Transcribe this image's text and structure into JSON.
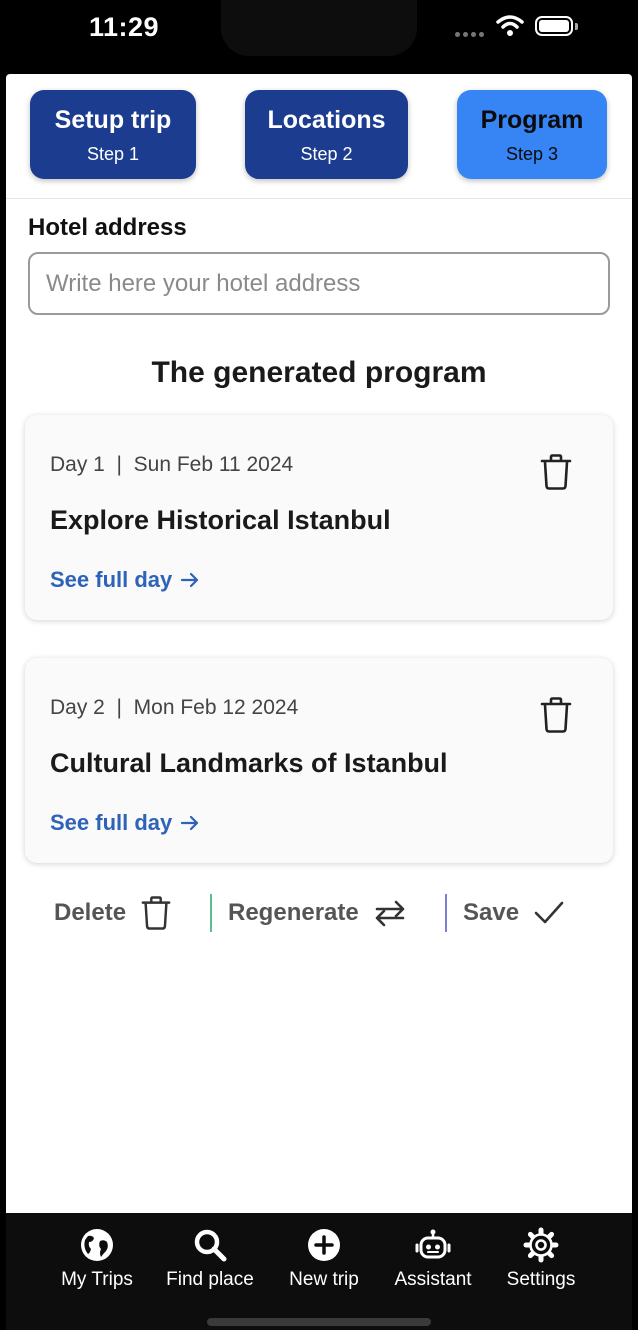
{
  "status_bar": {
    "time": "11:29"
  },
  "steps": [
    {
      "title": "Setup trip",
      "subtitle": "Step 1",
      "active": false
    },
    {
      "title": "Locations",
      "subtitle": "Step 2",
      "active": false
    },
    {
      "title": "Program",
      "subtitle": "Step 3",
      "active": true
    }
  ],
  "hotel": {
    "label": "Hotel address",
    "placeholder": "Write here your hotel address",
    "value": ""
  },
  "program": {
    "title": "The generated program",
    "days": [
      {
        "date": "Day 1  |  Sun Feb 11 2024",
        "title": "Explore Historical Istanbul",
        "link": "See full day"
      },
      {
        "date": "Day 2  |  Mon Feb 12 2024",
        "title": "Cultural Landmarks of Istanbul",
        "link": "See full day"
      }
    ]
  },
  "actions": {
    "delete": "Delete",
    "regenerate": "Regenerate",
    "save": "Save"
  },
  "tabbar": [
    {
      "label": "My Trips",
      "icon": "globe-icon"
    },
    {
      "label": "Find place",
      "icon": "search-icon"
    },
    {
      "label": "New trip",
      "icon": "plus-circle-icon"
    },
    {
      "label": "Assistant",
      "icon": "robot-icon"
    },
    {
      "label": "Settings",
      "icon": "gear-icon"
    }
  ],
  "colors": {
    "step_bg": "#1c3d8f",
    "step_active": "#3784f5",
    "link": "#2d63b8"
  }
}
